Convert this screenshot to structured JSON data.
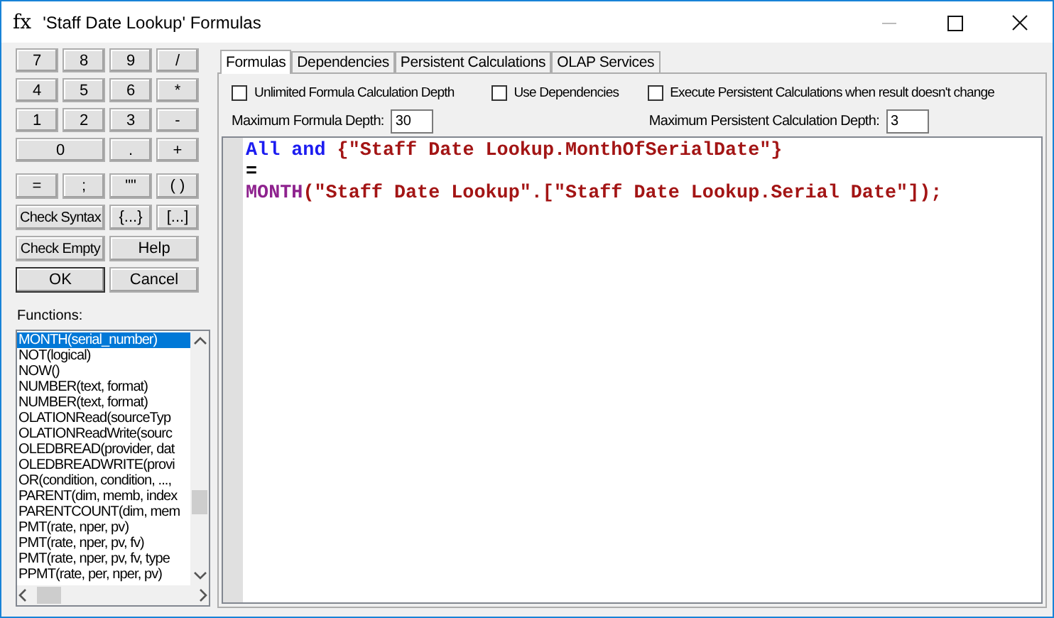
{
  "window": {
    "icon": "fx",
    "title": "'Staff Date Lookup' Formulas"
  },
  "keypad": [
    {
      "label": "7"
    },
    {
      "label": "8"
    },
    {
      "label": "9"
    },
    {
      "label": "/"
    },
    {
      "label": "4"
    },
    {
      "label": "5"
    },
    {
      "label": "6"
    },
    {
      "label": "*"
    },
    {
      "label": "1"
    },
    {
      "label": "2"
    },
    {
      "label": "3"
    },
    {
      "label": "-"
    },
    {
      "label": "0"
    },
    {
      "label": "."
    },
    {
      "label": "+"
    }
  ],
  "operators": [
    {
      "label": "="
    },
    {
      "label": ";"
    },
    {
      "label": "\"\""
    },
    {
      "label": "( )"
    },
    {
      "label": "Check Syntax"
    },
    {
      "label": "{...}"
    },
    {
      "label": "[...]"
    },
    {
      "label": "Check Empty"
    },
    {
      "label": "Help"
    },
    {
      "label": "OK",
      "default": true
    },
    {
      "label": "Cancel",
      "default": false
    }
  ],
  "functions": {
    "label": "Functions:",
    "items": [
      {
        "text": "MONTH(serial_number)",
        "selected": true
      },
      {
        "text": "NOT(logical)",
        "selected": false
      },
      {
        "text": "NOW()",
        "selected": false
      },
      {
        "text": "NUMBER(text, format)",
        "selected": false
      },
      {
        "text": "NUMBER(text, format)",
        "selected": false
      },
      {
        "text": "OLATIONRead(sourceTyp",
        "selected": false
      },
      {
        "text": "OLATIONReadWrite(sourc",
        "selected": false
      },
      {
        "text": "OLEDBREAD(provider, dat",
        "selected": false
      },
      {
        "text": "OLEDBREADWRITE(provi",
        "selected": false
      },
      {
        "text": "OR(condition, condition, ...,",
        "selected": false
      },
      {
        "text": "PARENT(dim, memb, index",
        "selected": false
      },
      {
        "text": "PARENTCOUNT(dim, mem",
        "selected": false
      },
      {
        "text": "PMT(rate, nper, pv)",
        "selected": false
      },
      {
        "text": "PMT(rate, nper, pv, fv)",
        "selected": false
      },
      {
        "text": "PMT(rate, nper, pv, fv, type",
        "selected": false
      },
      {
        "text": "PPMT(rate, per, nper, pv)",
        "selected": false
      }
    ]
  },
  "tabs": [
    {
      "label": "Formulas",
      "selected": true
    },
    {
      "label": "Dependencies",
      "selected": false
    },
    {
      "label": "Persistent Calculations",
      "selected": false
    },
    {
      "label": "OLAP Services",
      "selected": false
    }
  ],
  "options": [
    {
      "label": "Unlimited Formula Calculation Depth",
      "checked": false
    },
    {
      "label": "Use Dependencies",
      "checked": false
    },
    {
      "label": "Execute Persistent Calculations when result doesn't change",
      "checked": false
    }
  ],
  "depth_fields": [
    {
      "label": "Maximum Formula Depth:",
      "value": "30"
    },
    {
      "label": "Maximum Persistent Calculation Depth:",
      "value": "3"
    }
  ],
  "code": [
    [
      {
        "kind": "keyword",
        "text": "All"
      },
      {
        "kind": "keyword",
        "text": " and"
      },
      {
        "kind": "string",
        "text": " {\"Staff Date Lookup.MonthOfSerialDate\"}"
      }
    ],
    [
      {
        "kind": "plain",
        "text": "="
      }
    ],
    [
      {
        "kind": "function",
        "text": "MONTH"
      },
      {
        "kind": "string",
        "text": "(\"Staff Date Lookup\".[\"Staff Date Lookup.Serial Date\"]);"
      }
    ]
  ]
}
